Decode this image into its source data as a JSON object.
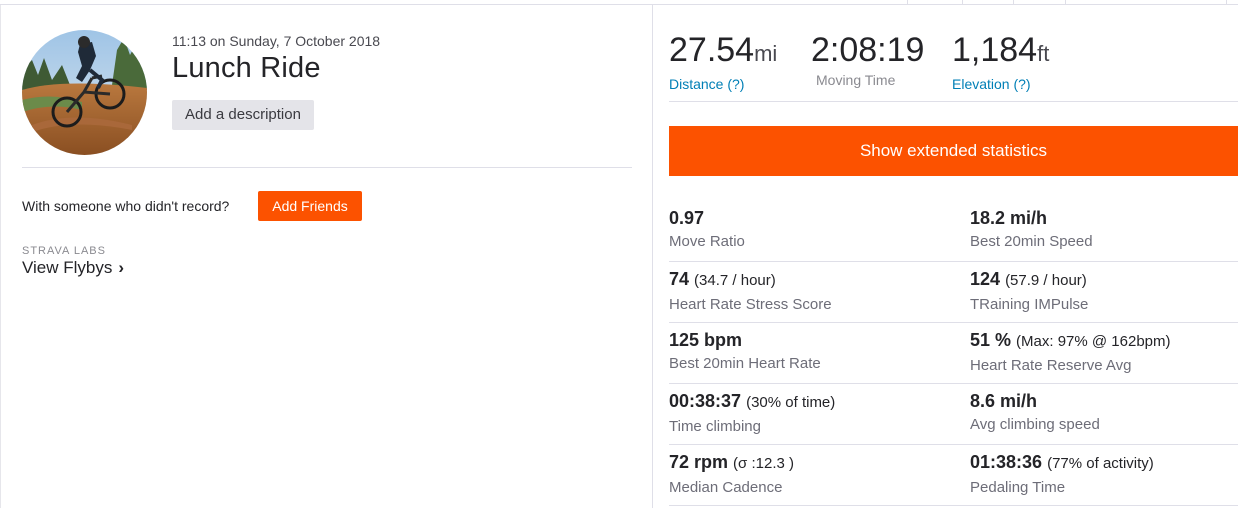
{
  "activity": {
    "datetime": "11:13 on Sunday, 7 October 2018",
    "title": "Lunch Ride",
    "add_description_label": "Add a description"
  },
  "friends": {
    "prompt": "With someone who didn't record?",
    "add_friends_label": "Add Friends"
  },
  "labs": {
    "heading": "STRAVA LABS",
    "flybys_label": "View Flybys",
    "chevron": "›"
  },
  "summary": {
    "distance": {
      "value": "27.54",
      "unit": "mi",
      "label": "Distance (?)"
    },
    "moving_time": {
      "value": "2:08:19",
      "label": "Moving Time"
    },
    "elevation": {
      "value": "1,184",
      "unit": "ft",
      "label": "Elevation (?)"
    }
  },
  "extended_button_label": "Show extended statistics",
  "stats": [
    [
      {
        "main": "0.97",
        "extra": "",
        "label": "Move Ratio"
      },
      {
        "main": "18.2 mi/h",
        "extra": "",
        "label": "Best 20min Speed"
      }
    ],
    [
      {
        "main": "74",
        "extra": "(34.7 / hour)",
        "label": "Heart Rate Stress Score"
      },
      {
        "main": "124",
        "extra": "(57.9 / hour)",
        "label": "TRaining IMPulse"
      }
    ],
    [
      {
        "main": "125 bpm",
        "extra": "",
        "label": "Best 20min Heart Rate"
      },
      {
        "main": "51 %",
        "extra": "(Max: 97% @ 162bpm)",
        "label": "Heart Rate Reserve Avg"
      }
    ],
    [
      {
        "main": "00:38:37",
        "extra": "(30% of time)",
        "label": "Time climbing"
      },
      {
        "main": "8.6 mi/h",
        "extra": "",
        "label": "Avg climbing speed"
      }
    ],
    [
      {
        "main": "72 rpm",
        "extra": "(σ :12.3 )",
        "label": "Median Cadence"
      },
      {
        "main": "01:38:36",
        "extra": "(77% of activity)",
        "label": "Pedaling Time"
      }
    ]
  ],
  "colors": {
    "accent": "#fc5200",
    "link": "#007fb6",
    "text": "#242428",
    "muted": "#6d6d78"
  }
}
